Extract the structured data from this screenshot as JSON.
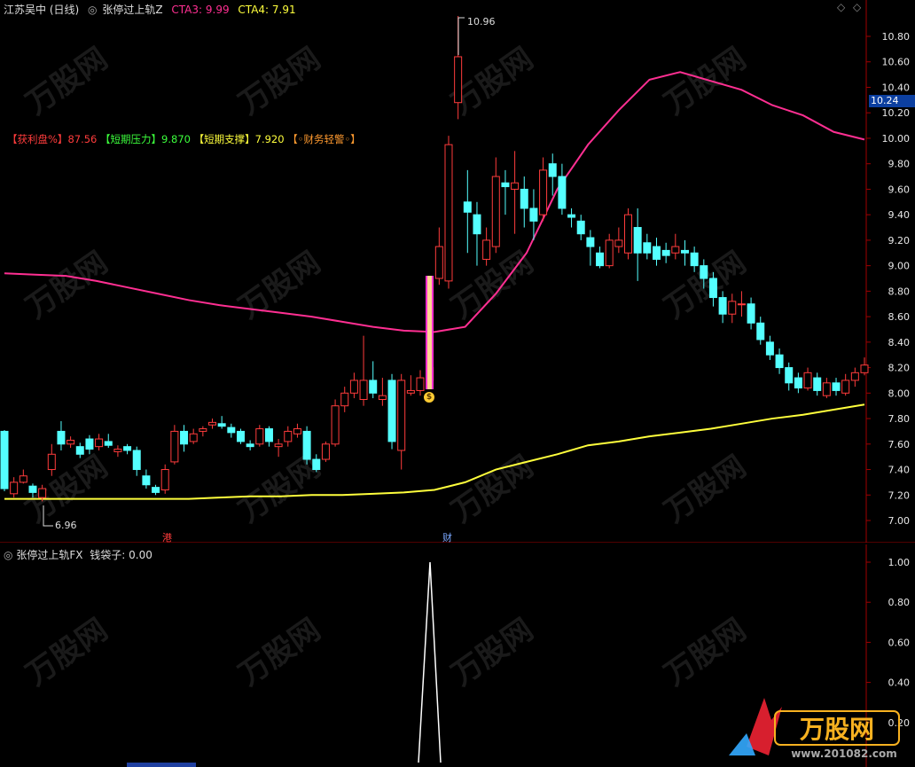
{
  "header": {
    "stock": "江苏吴中 (日线)",
    "indicator": "张停过上轨Z",
    "cta3_label": "CTA3: 9.99",
    "cta4_label": "CTA4: 7.91"
  },
  "info_line": {
    "profit_label": "【获利盘%】",
    "profit_value": "87.56",
    "pressure_label": "【短期压力】",
    "pressure_value": "9.870",
    "support_label": "【短期支撑】",
    "support_value": "7.920",
    "finance_label": "【◦财务轻警◦】"
  },
  "annotations": {
    "high": "10.96",
    "low": "6.96",
    "marker_gang": "港",
    "marker_cai": "财",
    "signal": "$"
  },
  "current_price": "10.24",
  "sub_header": {
    "indicator": "张停过上轨FX",
    "value_label": "钱袋子: 0.00"
  },
  "colors": {
    "up": "#ff3c3c",
    "down": "#54ffff",
    "cta3": "#ff2f92",
    "cta4": "#ffff3c",
    "axis": "#a00000"
  },
  "chart_data": [
    {
      "type": "candlestick",
      "title": "江苏吴中 (日线)",
      "ylim": [
        6.9,
        11.1
      ],
      "y_ticks": [
        "10.80",
        "10.60",
        "10.40",
        "10.20",
        "10.00",
        "9.80",
        "9.60",
        "9.40",
        "9.20",
        "9.00",
        "8.80",
        "8.60",
        "8.40",
        "8.20",
        "8.00",
        "7.80",
        "7.60",
        "7.40",
        "7.20",
        "7.00"
      ],
      "candles": [
        [
          7.7,
          7.25,
          7.71,
          7.23
        ],
        [
          7.21,
          7.3,
          7.34,
          7.18
        ],
        [
          7.3,
          7.35,
          7.4,
          7.29
        ],
        [
          7.27,
          7.22,
          7.29,
          7.18
        ],
        [
          7.18,
          7.25,
          7.28,
          7.15
        ],
        [
          7.4,
          7.52,
          7.6,
          7.35
        ],
        [
          7.7,
          7.6,
          7.78,
          7.55
        ],
        [
          7.6,
          7.63,
          7.66,
          7.57
        ],
        [
          7.58,
          7.52,
          7.61,
          7.49
        ],
        [
          7.64,
          7.56,
          7.67,
          7.52
        ],
        [
          7.58,
          7.64,
          7.68,
          7.55
        ],
        [
          7.62,
          7.59,
          7.68,
          7.57
        ],
        [
          7.54,
          7.56,
          7.59,
          7.5
        ],
        [
          7.58,
          7.55,
          7.6,
          7.52
        ],
        [
          7.55,
          7.4,
          7.58,
          7.35
        ],
        [
          7.35,
          7.28,
          7.4,
          7.25
        ],
        [
          7.26,
          7.22,
          7.28,
          7.2
        ],
        [
          7.24,
          7.4,
          7.44,
          7.21
        ],
        [
          7.46,
          7.7,
          7.75,
          7.44
        ],
        [
          7.7,
          7.6,
          7.75,
          7.54
        ],
        [
          7.62,
          7.68,
          7.72,
          7.6
        ],
        [
          7.7,
          7.72,
          7.74,
          7.66
        ],
        [
          7.75,
          7.77,
          7.8,
          7.72
        ],
        [
          7.76,
          7.74,
          7.82,
          7.72
        ],
        [
          7.73,
          7.69,
          7.76,
          7.65
        ],
        [
          7.7,
          7.62,
          7.72,
          7.6
        ],
        [
          7.6,
          7.58,
          7.63,
          7.55
        ],
        [
          7.6,
          7.72,
          7.75,
          7.58
        ],
        [
          7.72,
          7.62,
          7.74,
          7.58
        ],
        [
          7.58,
          7.6,
          7.64,
          7.5
        ],
        [
          7.62,
          7.7,
          7.74,
          7.58
        ],
        [
          7.68,
          7.72,
          7.76,
          7.65
        ],
        [
          7.7,
          7.48,
          7.74,
          7.44
        ],
        [
          7.48,
          7.4,
          7.52,
          7.38
        ],
        [
          7.48,
          7.6,
          7.62,
          7.46
        ],
        [
          7.6,
          7.9,
          7.95,
          7.58
        ],
        [
          7.9,
          8.0,
          8.05,
          7.85
        ],
        [
          8.0,
          8.1,
          8.16,
          7.96
        ],
        [
          7.95,
          8.1,
          8.45,
          7.9
        ],
        [
          8.1,
          8.0,
          8.25,
          7.96
        ],
        [
          7.95,
          7.98,
          8.12,
          7.9
        ],
        [
          8.1,
          7.62,
          8.15,
          7.56
        ],
        [
          7.55,
          8.1,
          8.15,
          7.4
        ],
        [
          8.0,
          8.02,
          8.14,
          7.98
        ],
        [
          8.02,
          8.12,
          8.18,
          7.98
        ],
        [
          8.1,
          8.2,
          8.9,
          8.05
        ],
        [
          8.9,
          9.15,
          9.3,
          8.85
        ],
        [
          8.88,
          9.95,
          10.02,
          8.82
        ],
        [
          10.28,
          10.64,
          10.96,
          10.15
        ],
        [
          9.5,
          9.42,
          9.75,
          9.1
        ],
        [
          9.4,
          9.25,
          9.5,
          9.0
        ],
        [
          9.05,
          9.2,
          9.3,
          9.0
        ],
        [
          9.15,
          9.7,
          9.85,
          9.1
        ],
        [
          9.65,
          9.62,
          9.75,
          9.4
        ],
        [
          9.6,
          9.65,
          9.9,
          9.25
        ],
        [
          9.6,
          9.45,
          9.7,
          9.3
        ],
        [
          9.45,
          9.35,
          9.6,
          9.2
        ],
        [
          9.4,
          9.75,
          9.85,
          9.35
        ],
        [
          9.8,
          9.7,
          9.88,
          9.55
        ],
        [
          9.7,
          9.45,
          9.8,
          9.4
        ],
        [
          9.4,
          9.38,
          9.45,
          9.3
        ],
        [
          9.35,
          9.25,
          9.4,
          9.2
        ],
        [
          9.22,
          9.15,
          9.28,
          9.0
        ],
        [
          9.1,
          9.0,
          9.15,
          8.98
        ],
        [
          9.0,
          9.2,
          9.25,
          8.98
        ],
        [
          9.15,
          9.2,
          9.3,
          9.1
        ],
        [
          9.1,
          9.4,
          9.45,
          9.05
        ],
        [
          9.3,
          9.1,
          9.45,
          8.88
        ],
        [
          9.18,
          9.1,
          9.25,
          9.05
        ],
        [
          9.15,
          9.05,
          9.22,
          9.0
        ],
        [
          9.12,
          9.08,
          9.18,
          9.02
        ],
        [
          9.1,
          9.15,
          9.25,
          9.05
        ],
        [
          9.12,
          9.1,
          9.2,
          9.0
        ],
        [
          9.1,
          9.0,
          9.15,
          8.95
        ],
        [
          9.0,
          8.9,
          9.05,
          8.82
        ],
        [
          8.9,
          8.75,
          8.95,
          8.68
        ],
        [
          8.75,
          8.62,
          8.8,
          8.55
        ],
        [
          8.62,
          8.72,
          8.78,
          8.55
        ],
        [
          8.7,
          8.7,
          8.8,
          8.6
        ],
        [
          8.7,
          8.55,
          8.75,
          8.5
        ],
        [
          8.55,
          8.42,
          8.6,
          8.38
        ],
        [
          8.4,
          8.3,
          8.45,
          8.26
        ],
        [
          8.3,
          8.2,
          8.35,
          8.15
        ],
        [
          8.2,
          8.08,
          8.24,
          8.02
        ],
        [
          8.12,
          8.04,
          8.16,
          8.0
        ],
        [
          8.04,
          8.16,
          8.2,
          8.02
        ],
        [
          8.12,
          8.02,
          8.16,
          7.98
        ],
        [
          7.98,
          8.08,
          8.12,
          7.96
        ],
        [
          8.08,
          8.02,
          8.12,
          7.98
        ],
        [
          8.0,
          8.1,
          8.15,
          7.98
        ],
        [
          8.1,
          8.16,
          8.2,
          8.05
        ],
        [
          8.16,
          8.22,
          8.28,
          8.14
        ]
      ],
      "series": [
        {
          "name": "CTA3",
          "values": [
            8.94,
            8.93,
            8.92,
            8.88,
            8.83,
            8.78,
            8.73,
            8.69,
            8.66,
            8.63,
            8.6,
            8.56,
            8.52,
            8.49,
            8.48,
            8.52,
            8.78,
            9.1,
            9.6,
            9.95,
            10.22,
            10.46,
            10.52,
            10.45,
            10.38,
            10.26,
            10.18,
            10.05,
            9.99
          ]
        },
        {
          "name": "CTA4",
          "values": [
            7.17,
            7.17,
            7.17,
            7.17,
            7.17,
            7.17,
            7.17,
            7.18,
            7.19,
            7.19,
            7.2,
            7.2,
            7.21,
            7.22,
            7.24,
            7.3,
            7.4,
            7.46,
            7.52,
            7.59,
            7.62,
            7.66,
            7.69,
            7.72,
            7.76,
            7.8,
            7.83,
            7.87,
            7.91
          ]
        }
      ]
    },
    {
      "type": "line",
      "title": "张停过上轨FX",
      "ylim": [
        0,
        1.05
      ],
      "y_ticks": [
        "1.00",
        "0.80",
        "0.60",
        "0.40",
        "0.20"
      ],
      "series": [
        {
          "name": "钱袋子",
          "values_note": "spike to 1.00 at the limit-up day, otherwise 0.00"
        }
      ]
    }
  ]
}
